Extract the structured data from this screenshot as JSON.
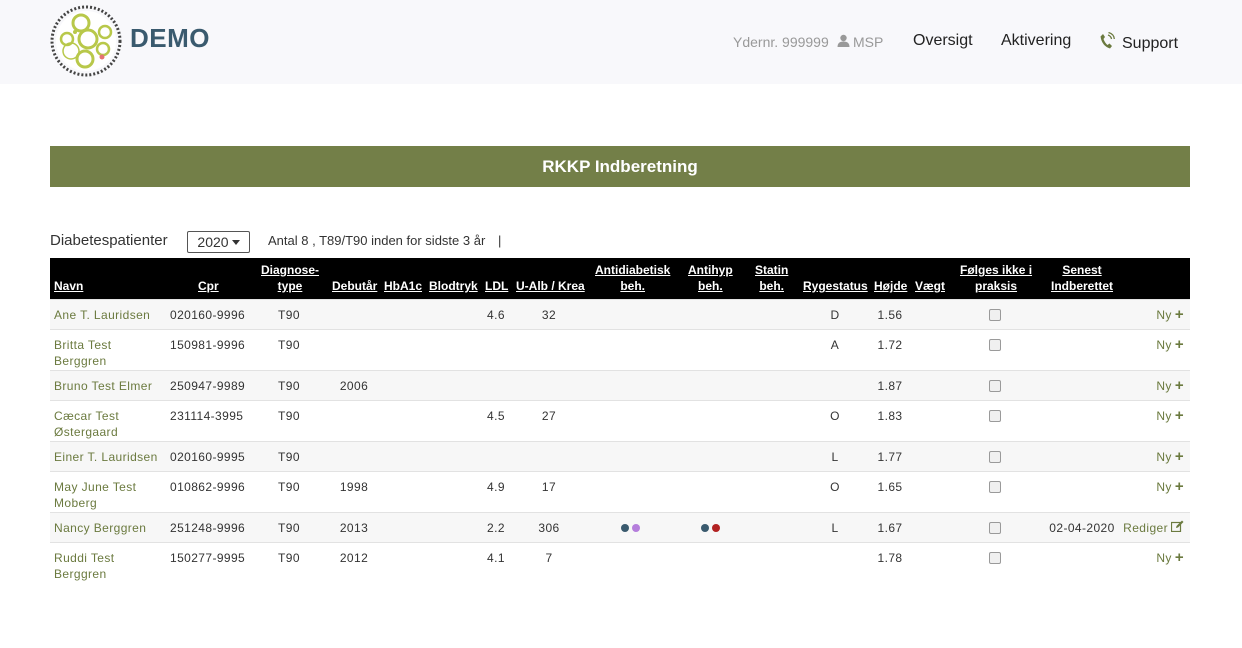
{
  "header": {
    "brand": "DEMO",
    "ydernr": "Ydernr. 999999",
    "user": "MSP",
    "nav": {
      "oversigt": "Oversigt",
      "aktivering": "Aktivering",
      "support": "Support"
    }
  },
  "banner": "RKKP Indberetning",
  "filter": {
    "label": "Diabetespatienter",
    "year": "2020",
    "count_text": "Antal 8 , T89/T90 inden for sidste 3 år",
    "separator": "|"
  },
  "columns": {
    "navn": "Navn",
    "cpr": "Cpr",
    "diagnose_1": "Diagnose-",
    "diagnose_2": "type",
    "debutaar": "Debutår",
    "hba1c": "HbA1c",
    "blodtryk": "Blodtryk",
    "ldl": "LDL",
    "ualb": "U-Alb / Krea",
    "antidiab_1": "Antidiabetisk",
    "antidiab_2": "beh.",
    "antihyp_1": "Antihyp",
    "antihyp_2": "beh.",
    "statin_1": "Statin",
    "statin_2": "beh.",
    "rygestatus": "Rygestatus",
    "hoejde": "Højde",
    "vaegt": "Vægt",
    "foelges_1": "Følges ikke i",
    "foelges_2": "praksis",
    "senest_1": "Senest",
    "senest_2": "Indberettet"
  },
  "colors": {
    "accent": "#737f48",
    "link": "#6b7a3f",
    "dot_blue": "#3a5a6e",
    "dot_purple": "#b57edc",
    "dot_red": "#b22222"
  },
  "rows": [
    {
      "name1": "Ane T. Lauridsen",
      "name2": "",
      "cpr": "020160-9996",
      "diagnose": "T90",
      "debut": "",
      "ldl": "4.6",
      "ualb": "32",
      "ryge": "D",
      "hoejde": "1.56",
      "senest": "",
      "action": "Ny",
      "antidiab_dots": [],
      "antihyp_dots": []
    },
    {
      "name1": "Britta Test",
      "name2": "Berggren",
      "cpr": "150981-9996",
      "diagnose": "T90",
      "debut": "",
      "ldl": "",
      "ualb": "",
      "ryge": "A",
      "hoejde": "1.72",
      "senest": "",
      "action": "Ny",
      "antidiab_dots": [],
      "antihyp_dots": []
    },
    {
      "name1": "Bruno Test Elmer",
      "name2": "",
      "cpr": "250947-9989",
      "diagnose": "T90",
      "debut": "2006",
      "ldl": "",
      "ualb": "",
      "ryge": "",
      "hoejde": "1.87",
      "senest": "",
      "action": "Ny",
      "antidiab_dots": [],
      "antihyp_dots": []
    },
    {
      "name1": "Cæcar Test",
      "name2": "Østergaard",
      "cpr": "231114-3995",
      "diagnose": "T90",
      "debut": "",
      "ldl": "4.5",
      "ualb": "27",
      "ryge": "O",
      "hoejde": "1.83",
      "senest": "",
      "action": "Ny",
      "antidiab_dots": [],
      "antihyp_dots": []
    },
    {
      "name1": "Einer T. Lauridsen",
      "name2": "",
      "cpr": "020160-9995",
      "diagnose": "T90",
      "debut": "",
      "ldl": "",
      "ualb": "",
      "ryge": "L",
      "hoejde": "1.77",
      "senest": "",
      "action": "Ny",
      "antidiab_dots": [],
      "antihyp_dots": []
    },
    {
      "name1": "May June Test",
      "name2": "Moberg",
      "cpr": "010862-9996",
      "diagnose": "T90",
      "debut": "1998",
      "ldl": "4.9",
      "ualb": "17",
      "ryge": "O",
      "hoejde": "1.65",
      "senest": "",
      "action": "Ny",
      "antidiab_dots": [],
      "antihyp_dots": []
    },
    {
      "name1": "Nancy Berggren",
      "name2": "",
      "cpr": "251248-9996",
      "diagnose": "T90",
      "debut": "2013",
      "ldl": "2.2",
      "ualb": "306",
      "ryge": "L",
      "hoejde": "1.67",
      "senest": "02-04-2020",
      "action": "Rediger",
      "antidiab_dots": [
        "#3a5a6e",
        "#b57edc"
      ],
      "antihyp_dots": [
        "#3a5a6e",
        "#b22222"
      ]
    },
    {
      "name1": "Ruddi Test",
      "name2": "Berggren",
      "cpr": "150277-9995",
      "diagnose": "T90",
      "debut": "2012",
      "ldl": "4.1",
      "ualb": "7",
      "ryge": "",
      "hoejde": "1.78",
      "senest": "",
      "action": "Ny",
      "antidiab_dots": [],
      "antihyp_dots": []
    }
  ]
}
